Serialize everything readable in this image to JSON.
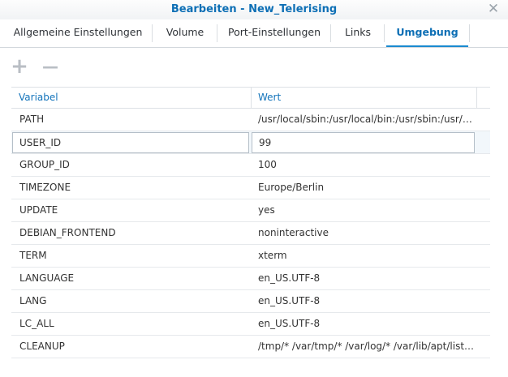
{
  "window": {
    "title": "Bearbeiten - New_Telerising"
  },
  "tabs": [
    {
      "label": "Allgemeine Einstellungen"
    },
    {
      "label": "Volume"
    },
    {
      "label": "Port-Einstellungen"
    },
    {
      "label": "Links"
    },
    {
      "label": "Umgebung",
      "active": true
    }
  ],
  "toolbar": {
    "add_symbol": "+",
    "remove_symbol": "—"
  },
  "table": {
    "headers": {
      "variable": "Variabel",
      "value": "Wert"
    },
    "rows": [
      {
        "name": "PATH",
        "value": "/usr/local/sbin:/usr/local/bin:/usr/sbin:/usr/bin:/sbin:/bin"
      },
      {
        "name": "USER_ID",
        "value": "99",
        "editing": true
      },
      {
        "name": "GROUP_ID",
        "value": "100"
      },
      {
        "name": "TIMEZONE",
        "value": "Europe/Berlin"
      },
      {
        "name": "UPDATE",
        "value": "yes"
      },
      {
        "name": "DEBIAN_FRONTEND",
        "value": "noninteractive"
      },
      {
        "name": "TERM",
        "value": "xterm"
      },
      {
        "name": "LANGUAGE",
        "value": "en_US.UTF-8"
      },
      {
        "name": "LANG",
        "value": "en_US.UTF-8"
      },
      {
        "name": "LC_ALL",
        "value": "en_US.UTF-8"
      },
      {
        "name": "CLEANUP",
        "value": "/tmp/* /var/tmp/* /var/log/* /var/lib/apt/lists/*"
      }
    ]
  },
  "colors": {
    "accent": "#0d6fb5",
    "header_text": "#1474bb"
  }
}
